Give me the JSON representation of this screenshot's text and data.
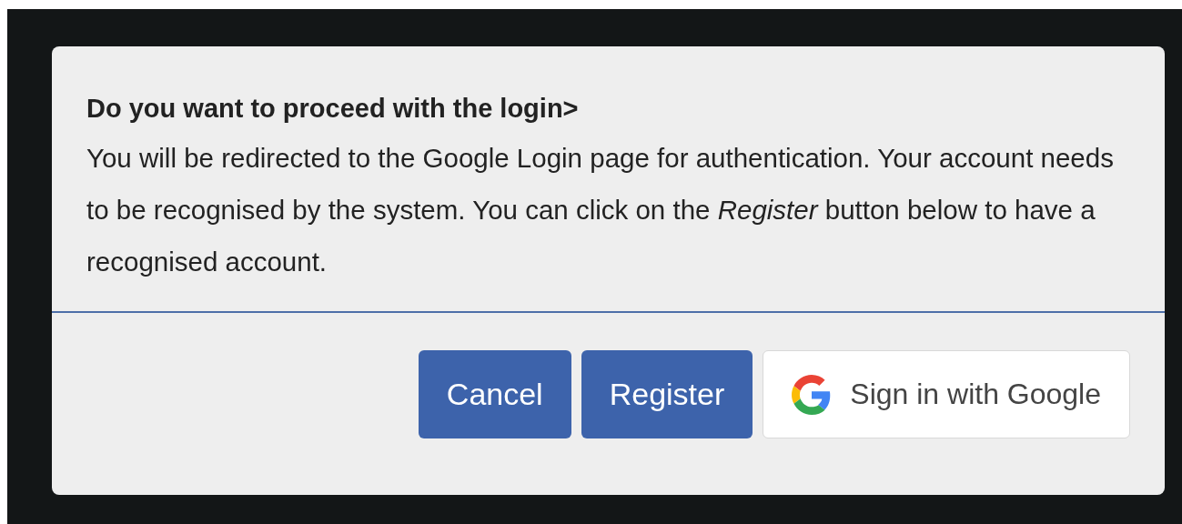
{
  "dialog": {
    "title": "Do you want to proceed with the login>",
    "message": "You will be redirected to the Google Login page for authentication. Your account needs to be recognised by the system. You can click on the *Register* button below to have a recognised account.",
    "buttons": [
      {
        "label": "Cancel",
        "kind": "primary"
      },
      {
        "label": "Register",
        "kind": "primary"
      },
      {
        "label": "Sign in with Google",
        "kind": "google"
      }
    ]
  }
}
